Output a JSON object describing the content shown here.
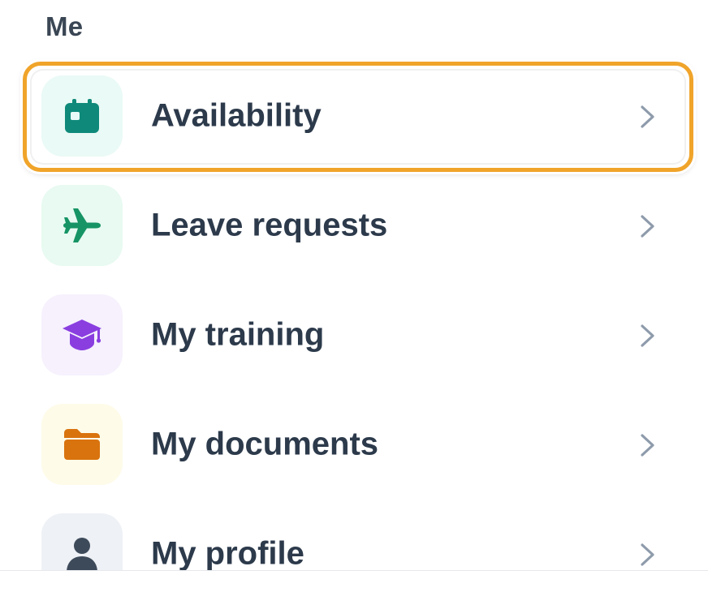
{
  "section": {
    "title": "Me"
  },
  "menu": {
    "items": [
      {
        "label": "Availability",
        "icon": "calendar-icon",
        "icon_color": "#0f8a7a",
        "icon_bg": "#eafaf6",
        "highlighted": true
      },
      {
        "label": "Leave requests",
        "icon": "airplane-icon",
        "icon_color": "#169466",
        "icon_bg": "#e8faf1",
        "highlighted": false
      },
      {
        "label": "My training",
        "icon": "graduation-cap-icon",
        "icon_color": "#8a3ee0",
        "icon_bg": "#f6f1fd",
        "highlighted": false
      },
      {
        "label": "My documents",
        "icon": "folder-icon",
        "icon_color": "#d9730e",
        "icon_bg": "#fefbe9",
        "highlighted": false
      },
      {
        "label": "My profile",
        "icon": "person-icon",
        "icon_color": "#3d4a5a",
        "icon_bg": "#eef1f5",
        "highlighted": false
      }
    ],
    "chevron_icon": "chevron-right-icon",
    "chevron_color": "#8e9bab",
    "highlight_color": "#f0a42a"
  }
}
